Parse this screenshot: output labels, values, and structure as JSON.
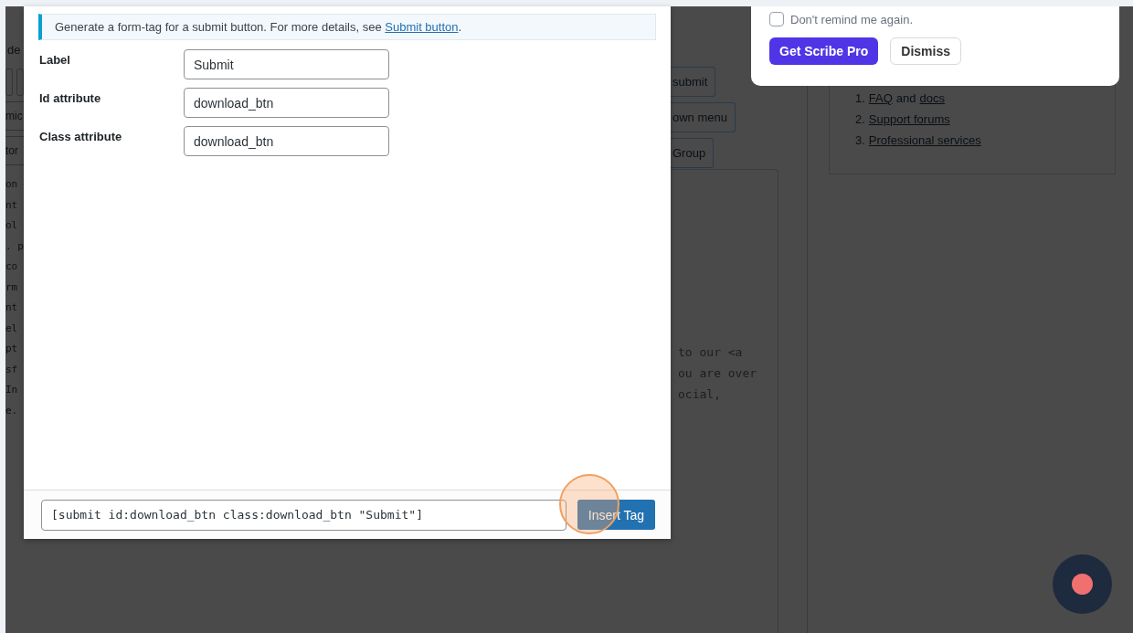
{
  "background_page": {
    "left_fragment": "de",
    "left_buttons": [
      "mic",
      "tor"
    ],
    "code_lines": [
      "on",
      "nt",
      "ol",
      ". p",
      "co",
      "rm",
      "nt",
      "el",
      "pt",
      "sf",
      "In",
      "e."
    ],
    "tag_buttons": [
      "submit",
      "own menu",
      "Group"
    ],
    "editor_lines": [
      "to our <a",
      "ou are over",
      "ocial,"
    ],
    "help_list": [
      {
        "number": "1.",
        "parts": [
          {
            "text": "FAQ",
            "link": true
          },
          {
            "text": "and",
            "link": false
          },
          {
            "text": "docs",
            "link": true
          }
        ]
      },
      {
        "number": "2.",
        "parts": [
          {
            "text": "Support forums",
            "link": true
          }
        ]
      },
      {
        "number": "3.",
        "parts": [
          {
            "text": "Professional services",
            "link": true
          }
        ]
      }
    ]
  },
  "reminder_popup": {
    "checkbox": {
      "label": "Don't remind me again.",
      "checked": false
    },
    "buttons": [
      {
        "label": "Get Scribe Pro",
        "kind": "primary"
      },
      {
        "label": "Dismiss",
        "kind": "secondary"
      }
    ]
  },
  "modal": {
    "notice": {
      "text": "Generate a form-tag for a submit button. For more details, see",
      "link": "Submit button",
      "end": "."
    },
    "fields": [
      {
        "label": "Label",
        "value": "Submit"
      },
      {
        "label": "Id attribute",
        "value": "download_btn"
      },
      {
        "label": "Class attribute",
        "value": "download_btn"
      }
    ],
    "tag_code": "[submit id:download_btn class:download_btn \"Submit\"]",
    "insert_button": "Insert Tag"
  }
}
